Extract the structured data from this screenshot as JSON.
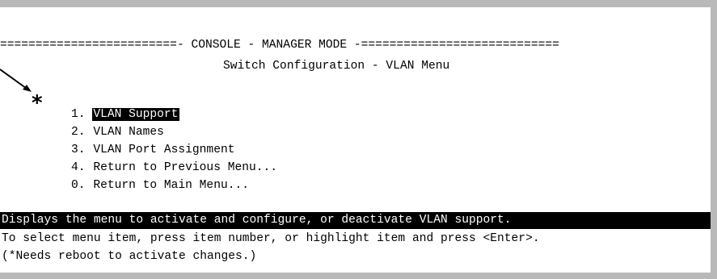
{
  "window": {
    "header": "=========================- CONSOLE - MANAGER MODE -============================",
    "subtitle": "Switch Configuration - VLAN Menu"
  },
  "menu": {
    "asterisk": "*",
    "items": [
      {
        "number": "1. ",
        "label": "VLAN Support",
        "selected": true
      },
      {
        "number": "2. ",
        "label": "VLAN Names",
        "selected": false
      },
      {
        "number": "3. ",
        "label": "VLAN Port Assignment",
        "selected": false
      },
      {
        "number": "4. ",
        "label": "Return to Previous Menu...",
        "selected": false
      },
      {
        "number": "0. ",
        "label": "Return to Main Menu...",
        "selected": false
      }
    ]
  },
  "status": {
    "help": "Displays the menu to activate and configure, or deactivate VLAN support.",
    "instruction": "To select menu item, press item number, or highlight item and press <Enter>.",
    "note": "(*Needs reboot to activate changes.)"
  },
  "colors": {
    "frame": "#b9b9b9",
    "highlight_bg": "#000000",
    "highlight_fg": "#ffffff"
  },
  "icons": {
    "annotation": "arrow-pointer-icon"
  }
}
